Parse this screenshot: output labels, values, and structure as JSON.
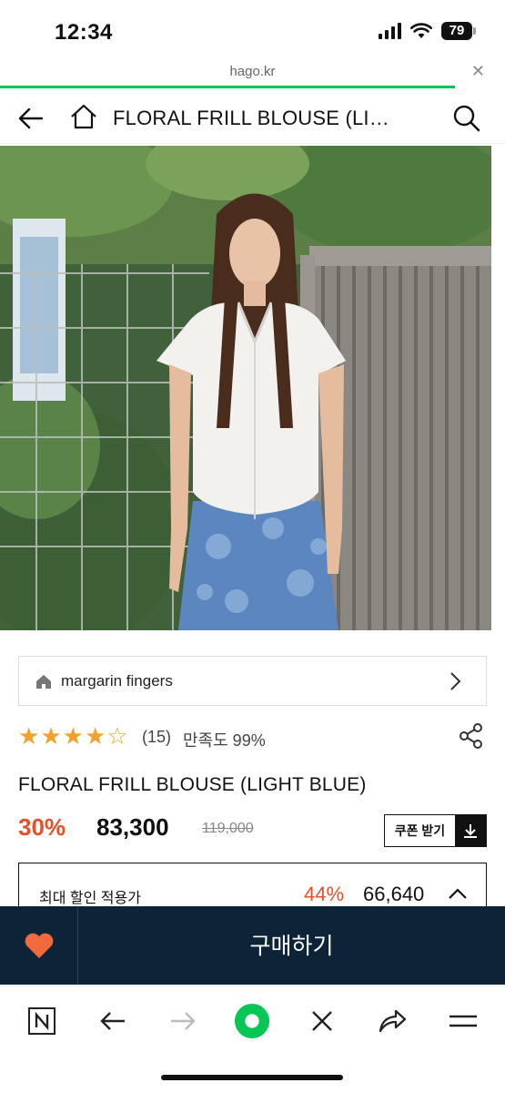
{
  "status_bar": {
    "time": "12:34",
    "battery": "79"
  },
  "browser": {
    "url": "hago.kr",
    "load_progress": 0.9
  },
  "header": {
    "title": "FLORAL FRILL BLOUSE (LI…"
  },
  "brand": {
    "name": "margarin fingers"
  },
  "rating": {
    "stars": 4,
    "max_stars": 5,
    "review_count": "(15)",
    "satisfaction": "만족도 99%"
  },
  "product": {
    "title": "FLORAL FRILL BLOUSE (LIGHT BLUE)",
    "discount": "30%",
    "price": "83,300",
    "original_price": "119,000",
    "coupon_label": "쿠폰 받기"
  },
  "max_discount": {
    "label": "최대 할인 적용가",
    "percent": "44%",
    "price": "66,640"
  },
  "buy_bar": {
    "buy_label": "구매하기"
  },
  "colors": {
    "accent_orange": "#e8502a",
    "navy": "#0d2438",
    "naver_green": "#06c755",
    "heart": "#f26a3c",
    "star": "#f2a22c"
  },
  "icons": {
    "header": [
      "back-arrow-icon",
      "home-icon",
      "search-icon"
    ],
    "toolbar": [
      "naver-n-icon",
      "back-icon",
      "forward-icon",
      "green-dot-icon",
      "close-icon",
      "share-icon",
      "menu-icon"
    ]
  }
}
